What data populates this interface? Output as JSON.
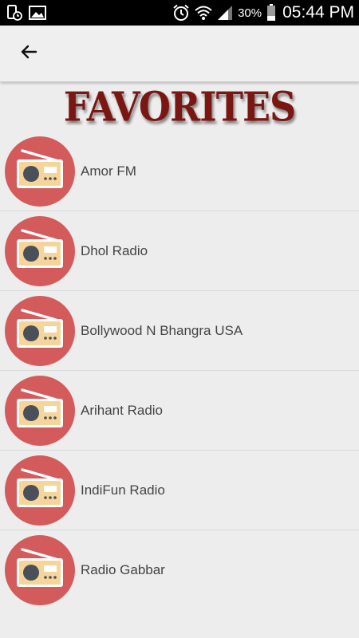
{
  "status_bar": {
    "battery_percent": "30%",
    "time": "05:44 PM",
    "icons": [
      "notification-phone-icon",
      "image-icon",
      "alarm-icon",
      "wifi-icon",
      "signal-icon",
      "battery-icon"
    ]
  },
  "app_bar": {
    "back_icon": "arrow-left-icon"
  },
  "page": {
    "title": "FAVORITES"
  },
  "favorites": [
    {
      "name": "Amor FM",
      "icon": "radio-icon"
    },
    {
      "name": "Dhol Radio",
      "icon": "radio-icon"
    },
    {
      "name": "Bollywood N Bhangra USA",
      "icon": "radio-icon"
    },
    {
      "name": "Arihant Radio",
      "icon": "radio-icon"
    },
    {
      "name": "IndiFun Radio",
      "icon": "radio-icon"
    },
    {
      "name": "Radio Gabbar",
      "icon": "radio-icon"
    }
  ],
  "colors": {
    "title": "#7a1712",
    "icon_circle": "#d45b5b",
    "radio_body": "#f5d59a",
    "status_bar": "#000000"
  }
}
